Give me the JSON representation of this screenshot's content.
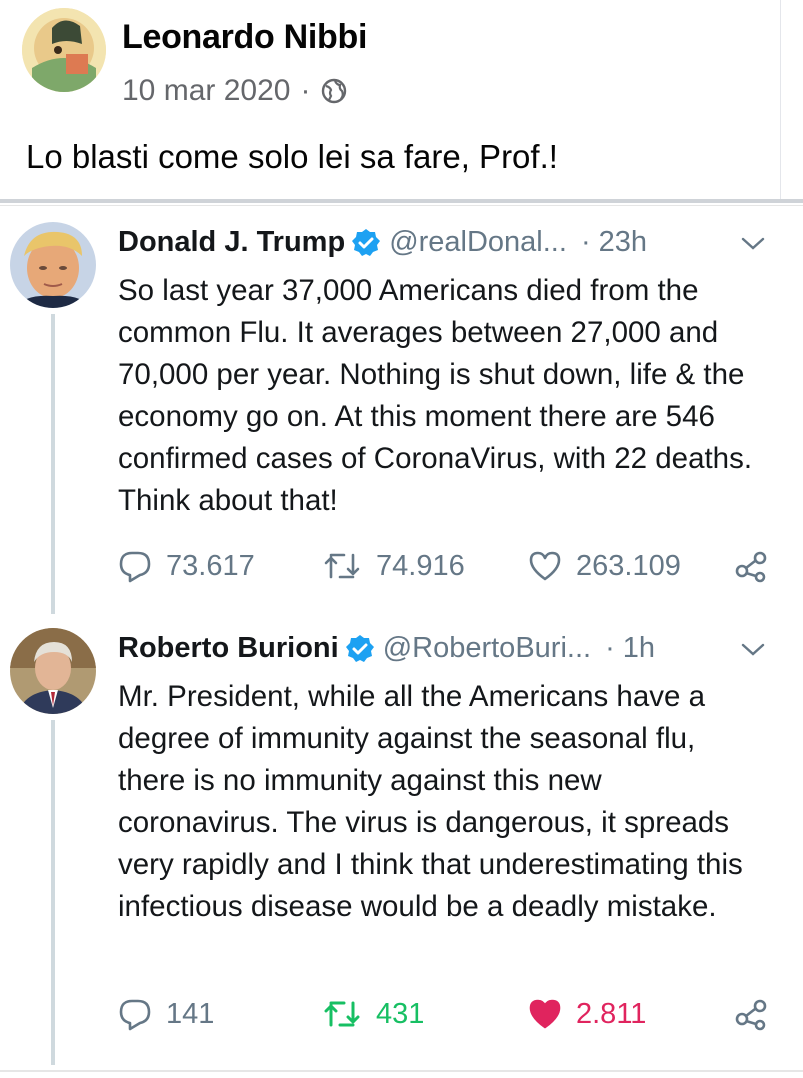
{
  "post": {
    "author": "Leonardo Nibbi",
    "date": "10 mar 2020",
    "separator": "·",
    "caption": "Lo blasti come solo lei sa fare, Prof.!"
  },
  "tweets": [
    {
      "name": "Donald J. Trump",
      "handle": "@realDonal...",
      "time": "· 23h",
      "text": "So last year 37,000 Americans died from the common Flu. It averages between 27,000 and 70,000 per year. Nothing is shut down, life & the economy go on. At this moment there are 546 confirmed cases of CoronaVirus, with 22 deaths. Think about that!",
      "replies": "73.617",
      "retweets": "74.916",
      "likes": "263.109",
      "liked": false,
      "retweeted": false
    },
    {
      "name": "Roberto Burioni",
      "handle": "@RobertoBuri...",
      "time": "· 1h",
      "text": "Mr. President, while all the Americans have a degree of immunity against the seasonal flu, there is no immunity against this new coronavirus. The virus is dangerous, it spreads very rapidly and I think that underestimating this infectious disease would be a deadly mistake.",
      "replies": "141",
      "retweets": "431",
      "likes": "2.811",
      "liked": true,
      "retweeted": true
    }
  ],
  "icons": [
    "globe-icon",
    "verified-icon",
    "chevron-down-icon",
    "reply-icon",
    "retweet-icon",
    "heart-icon",
    "share-icon"
  ],
  "colors": {
    "verified": "#1da1f2",
    "retweet_active": "#17bf63",
    "like_active": "#e0245e",
    "muted": "#657786"
  }
}
